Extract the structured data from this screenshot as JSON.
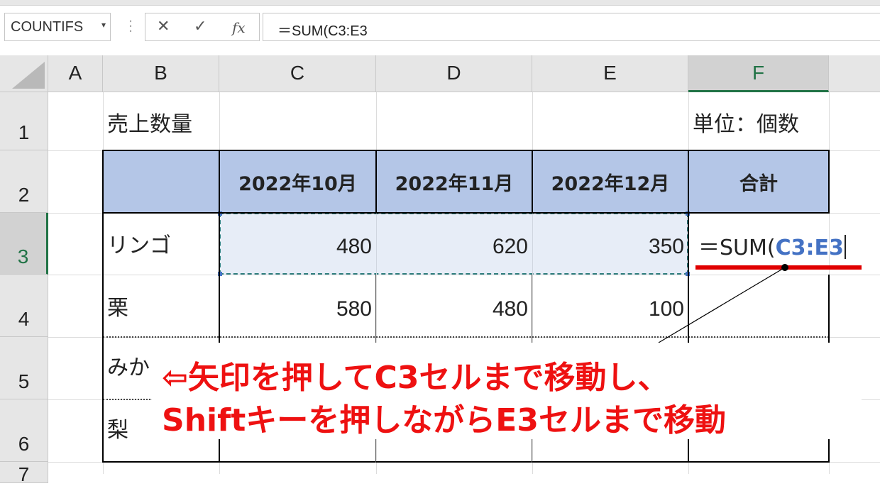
{
  "formula_bar": {
    "name_box": "COUNTIFS",
    "name_box_arrow": "▾",
    "more_glyph": "⋮",
    "cancel_glyph": "✕",
    "enter_glyph": "✓",
    "fx_glyph": "fx",
    "formula": "＝SUM(C3:E3"
  },
  "columns": [
    "A",
    "B",
    "C",
    "D",
    "E",
    "F"
  ],
  "rows": [
    "1",
    "2",
    "3",
    "4",
    "5",
    "6",
    "7"
  ],
  "cells": {
    "B1": "売上数量",
    "F1": "単位：個数",
    "C2": "2022年10月",
    "D2": "2022年11月",
    "E2": "2022年12月",
    "F2": "合計",
    "B3": "リンゴ",
    "C3": "480",
    "D3": "620",
    "E3": "350",
    "B4": "栗",
    "C4": "580",
    "D4": "480",
    "E4": "100",
    "B5": "みか",
    "B6": "梨"
  },
  "active_cell": {
    "prefix": "＝SUM(",
    "ref": "C3:E3"
  },
  "annotation": {
    "line1": "⇦矢印を押してC3セルまで移動し、",
    "line2": "Shiftキーを押しながらE3セルまで移動",
    "color": "#ee1111"
  },
  "colors": {
    "header_fill": "#b4c6e7",
    "selection_fill": "#e7edf7",
    "reference_blue": "#4472c4",
    "excel_green": "#217346"
  }
}
